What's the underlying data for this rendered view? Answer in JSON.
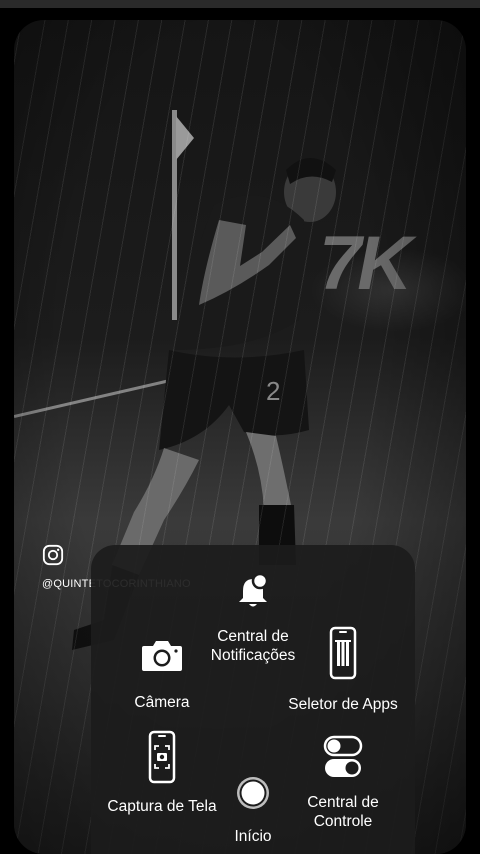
{
  "overlay": {
    "instagram_handle": "@QUINTETOCORINTHIANO"
  },
  "wallpaper": {
    "ad_board_text": "7K"
  },
  "assistive_menu": {
    "items": [
      {
        "label": "Central de Notificações",
        "icon": "bell-icon"
      },
      {
        "label": "Câmera",
        "icon": "camera-icon"
      },
      {
        "label": "Seletor de Apps",
        "icon": "app-switcher-icon"
      },
      {
        "label": "Captura de Tela",
        "icon": "screenshot-icon"
      },
      {
        "label": "Início",
        "icon": "home-button-icon"
      },
      {
        "label": "Central de Controle",
        "icon": "toggle-switches-icon"
      }
    ]
  }
}
